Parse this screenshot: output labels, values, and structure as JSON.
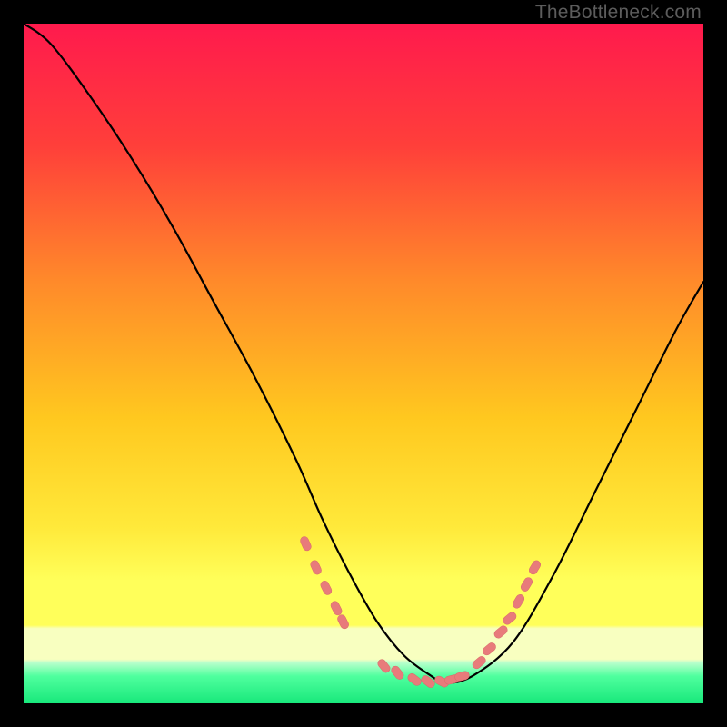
{
  "watermark": "TheBottleneck.com",
  "colors": {
    "background": "#000000",
    "gradient_top": "#ff1a4d",
    "gradient_mid_upper": "#ff6a2a",
    "gradient_mid": "#ffd21f",
    "gradient_yellow_band": "#ffff5a",
    "gradient_light_band": "#f6ffba",
    "gradient_bottom": "#18ff7e",
    "curve": "#000000",
    "marker_fill": "#e87b7b",
    "marker_stroke": "#d86a6a"
  },
  "chart_data": {
    "type": "line",
    "title": "",
    "xlabel": "",
    "ylabel": "",
    "xlim": [
      0,
      100
    ],
    "ylim": [
      0,
      100
    ],
    "curve": {
      "x": [
        0,
        4,
        10,
        16,
        22,
        28,
        34,
        40,
        44,
        48,
        52,
        56,
        60,
        62,
        66,
        72,
        78,
        84,
        90,
        96,
        100
      ],
      "y": [
        100,
        97,
        89,
        80,
        70,
        59,
        48,
        36,
        27,
        19,
        12,
        7,
        4,
        3,
        4,
        9,
        19,
        31,
        43,
        55,
        62
      ]
    },
    "markers": {
      "x": [
        41.5,
        43.0,
        44.5,
        46.0,
        47.0,
        53.0,
        55.0,
        57.5,
        59.5,
        61.5,
        63.0,
        64.5,
        67.0,
        68.5,
        70.2,
        71.5,
        72.8,
        74.0,
        75.2
      ],
      "y": [
        23.5,
        20.0,
        17.0,
        14.0,
        12.0,
        5.5,
        4.5,
        3.5,
        3.2,
        3.2,
        3.5,
        4.0,
        6.0,
        8.0,
        10.5,
        12.5,
        15.0,
        17.5,
        20.0
      ]
    }
  }
}
